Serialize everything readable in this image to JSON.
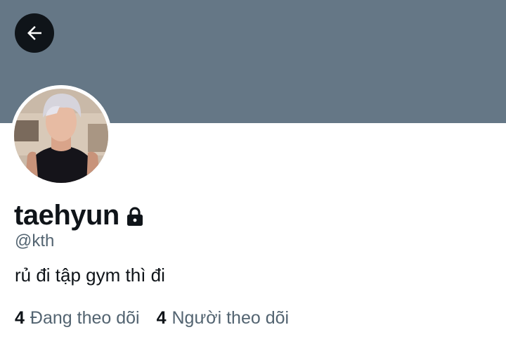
{
  "header": {
    "banner_color": "#657786",
    "back_icon": "arrow-left-icon"
  },
  "profile": {
    "display_name": "taehyun",
    "protected_icon": "lock-icon",
    "handle": "@kth",
    "bio": "rủ đi tập gym thì đi"
  },
  "stats": {
    "following_count": "4",
    "following_label": "Đang theo dõi",
    "followers_count": "4",
    "followers_label": "Người theo dõi"
  }
}
